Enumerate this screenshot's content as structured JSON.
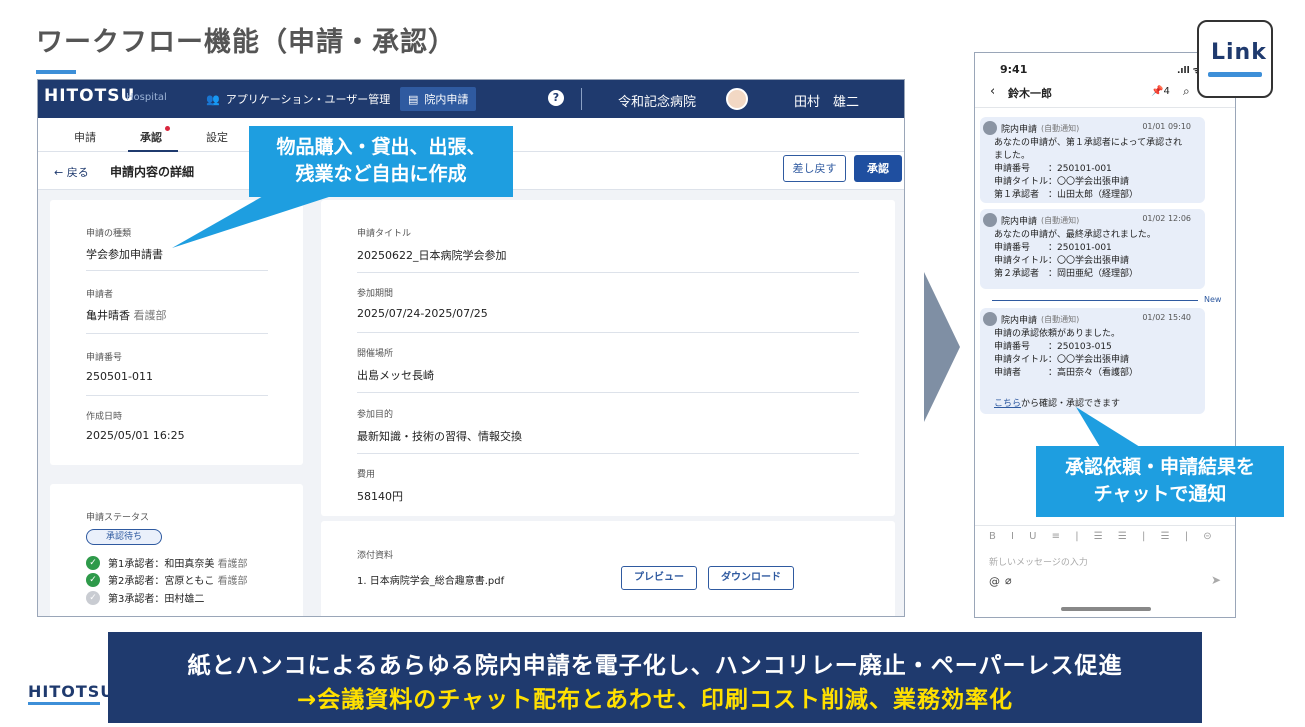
{
  "slide": {
    "title": "ワークフロー機能（申請・承認）"
  },
  "app": {
    "brand": "HITOTSU",
    "brand_sub": "Hospital",
    "nav_users": "アプリケーション・ユーザー管理",
    "nav_requests": "院内申請",
    "help": "?",
    "hospital": "令和記念病院",
    "user": "田村　雄二",
    "tabs": [
      "申請",
      "承認",
      "設定"
    ],
    "back": "戻る",
    "detail_title": "申請内容の詳細",
    "return_button": "差し戻す",
    "approve_button": "承認",
    "left_fields": [
      {
        "label": "申請の種類",
        "value": "学会参加申請書",
        "sub": ""
      },
      {
        "label": "申請者",
        "value": "亀井晴香",
        "sub": "看護部"
      },
      {
        "label": "申請番号",
        "value": "250501-011",
        "sub": ""
      },
      {
        "label": "作成日時",
        "value": "2025/05/01 16:25",
        "sub": ""
      }
    ],
    "status": {
      "label": "申請ステータス",
      "pill": "承認待ち",
      "steps": [
        {
          "text": "第1承認者：和田真奈美",
          "dept": "看護部",
          "done": true
        },
        {
          "text": "第2承認者：宮原ともこ",
          "dept": "看護部",
          "done": true
        },
        {
          "text": "第3承認者：田村雄二",
          "dept": "",
          "done": false
        }
      ]
    },
    "main_fields": [
      {
        "label": "申請タイトル",
        "value": "20250622_日本病院学会参加"
      },
      {
        "label": "参加期間",
        "value": "2025/07/24-2025/07/25"
      },
      {
        "label": "開催場所",
        "value": "出島メッセ長崎"
      },
      {
        "label": "参加目的",
        "value": "最新知識・技術の習得、情報交換"
      },
      {
        "label": "費用",
        "value": "58140円"
      }
    ],
    "attachment": {
      "label": "添付資料",
      "file": "1. 日本病院学会_総合趣意書.pdf",
      "preview": "プレビュー",
      "download": "ダウンロード"
    }
  },
  "callouts": {
    "left": [
      "物品購入・貸出、出張、",
      "残業など自由に作成"
    ],
    "right": [
      "承認依頼・申請結果を",
      "チャットで通知"
    ]
  },
  "phone": {
    "time": "9:41",
    "signal": ".ıll ᯤ",
    "contact": "鈴木一郎",
    "pins": "4",
    "messages": [
      {
        "sender": "院内申請",
        "auto": "(自動通知)",
        "time": "01/01 09:10",
        "body": "あなたの申請が、第１承認者によって承認され\nました。\n申請番号　　：250101-001\n申請タイトル：〇〇学会出張申請\n第１承認者　：山田太郎（経理部）"
      },
      {
        "sender": "院内申請",
        "auto": "(自動通知)",
        "time": "01/02 12:06",
        "body": "あなたの申請が、最終承認されました。\n申請番号　　：250101-001\n申請タイトル：〇〇学会出張申請\n第２承認者　：岡田亜紀（経理部）"
      },
      {
        "sender": "院内申請",
        "auto": "(自動通知)",
        "time": "01/02 15:40",
        "body": "申請の承認依頼がありました。\n申請番号　　：250103-015\n申請タイトル：〇〇学会出張申請\n申請者　　　：高田奈々（看護部）"
      }
    ],
    "link_word": "こちら",
    "link_rest": "から確認・承認できます",
    "new_label": "New",
    "toolbar": "B I U ≡ | ☰ ☰ | ☰ | ⊝",
    "input_placeholder": "新しいメッセージの入力"
  },
  "logo": {
    "link": "Link"
  },
  "footer": {
    "logo": "HITOTSU",
    "line1": "紙とハンコによるあらゆる院内申請を電子化し、ハンコリレー廃止・ペーパーレス促進",
    "line2": "→会議資料のチャット配布とあわせ、印刷コスト削減、業務効率化"
  },
  "colors": {
    "navy": "#1f3a6e",
    "accent": "#1e9ee0",
    "yellow": "#ffe000"
  }
}
